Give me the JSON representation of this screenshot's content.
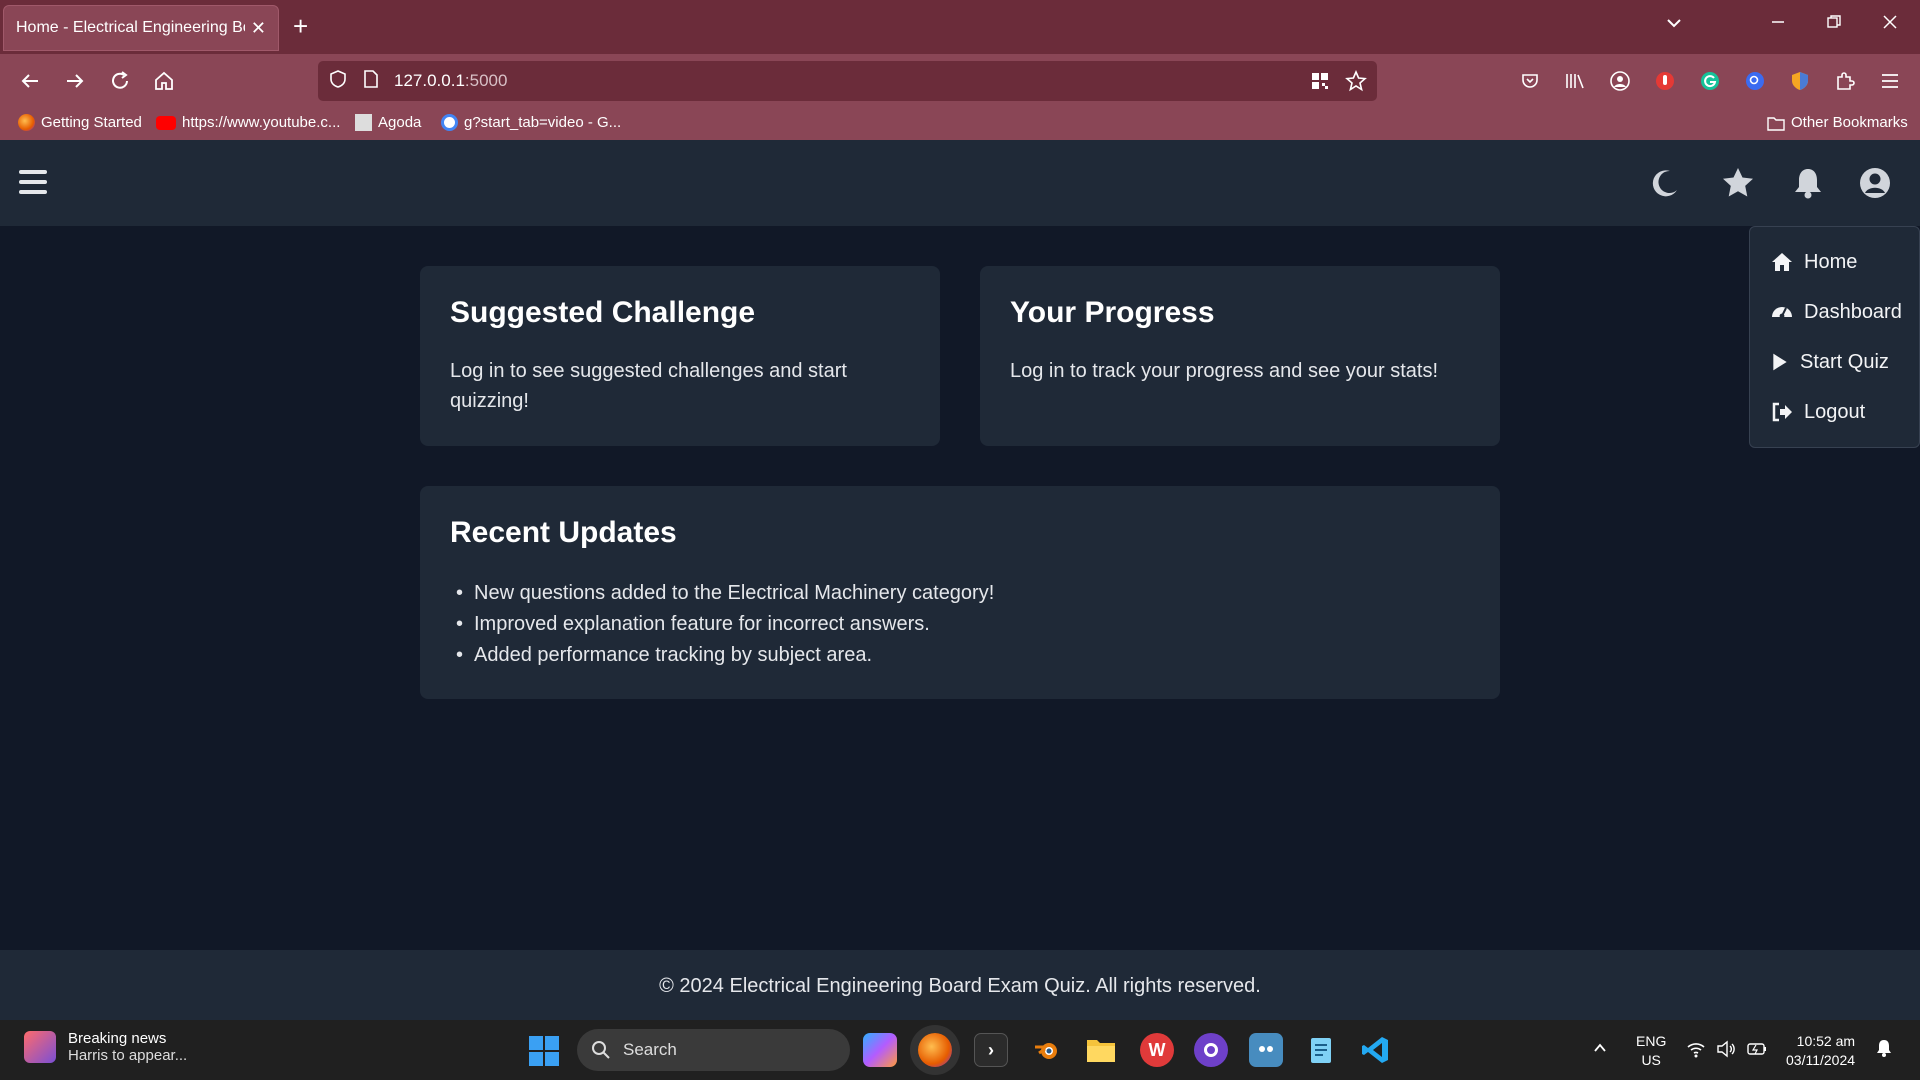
{
  "browser": {
    "tab_title": "Home - Electrical Engineering Board Exam Quiz",
    "tab_close": "✕",
    "new_tab": "+",
    "url_host": "127.0.0.1",
    "url_port": ":5000",
    "bookmarks": [
      "Getting Started",
      "https://www.youtube.c...",
      "Agoda",
      "g?start_tab=video - G..."
    ],
    "other_bookmarks": "Other Bookmarks"
  },
  "cards": {
    "suggested": {
      "title": "Suggested Challenge",
      "text": "Log in to see suggested challenges and start quizzing!"
    },
    "progress": {
      "title": "Your Progress",
      "text": "Log in to track your progress and see your stats!"
    },
    "updates": {
      "title": "Recent Updates",
      "items": [
        "New questions added to the Electrical Machinery category!",
        "Improved explanation feature for incorrect answers.",
        "Added performance tracking by subject area."
      ]
    }
  },
  "menu": {
    "items": [
      "Home",
      "Dashboard",
      "Start Quiz",
      "Logout"
    ]
  },
  "footer": {
    "text": "© 2024 Electrical Engineering Board Exam Quiz. All rights reserved."
  },
  "taskbar": {
    "news_title": "Breaking news",
    "news_sub": "Harris to appear...",
    "search_label": "Search",
    "lang_top": "ENG",
    "lang_bottom": "US",
    "time": "10:52 am",
    "date": "03/11/2024"
  },
  "colors": {
    "tabstrip": "#6b2c3a",
    "toolbar": "#8a4656",
    "page_bg": "#111827",
    "card_bg": "#1f2937"
  }
}
